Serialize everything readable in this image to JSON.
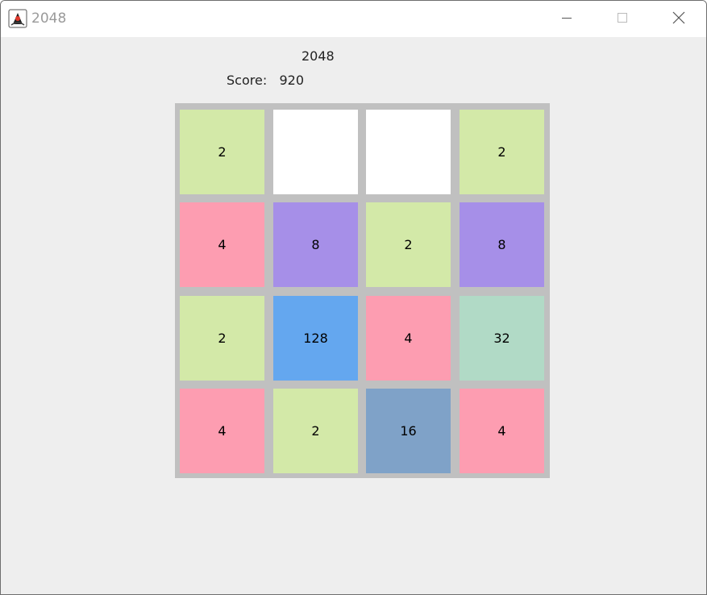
{
  "window": {
    "title": "2048",
    "icon": "java-duke-icon",
    "controls": [
      "minimize-icon",
      "maximize-icon",
      "close-icon"
    ]
  },
  "game": {
    "title": "2048",
    "score_label": "Score:",
    "score_value": "920"
  },
  "board": {
    "rows": [
      [
        "2",
        "",
        "",
        "2"
      ],
      [
        "4",
        "8",
        "2",
        "8"
      ],
      [
        "2",
        "128",
        "4",
        "32"
      ],
      [
        "4",
        "2",
        "16",
        "4"
      ]
    ]
  },
  "colors": {
    "board_background": "#c0c0c0",
    "empty": "#ffffff",
    "2": "#d3e9a8",
    "4": "#fd9db1",
    "8": "#a68fe8",
    "16": "#7fa2c8",
    "32": "#b1dac6",
    "128": "#64a7ef"
  }
}
